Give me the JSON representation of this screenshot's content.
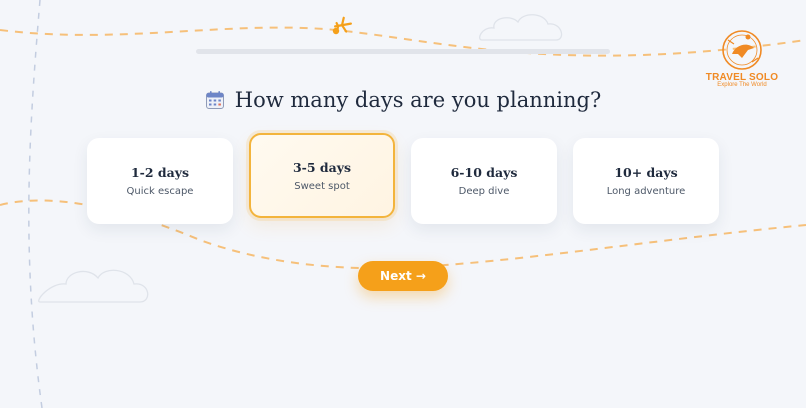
{
  "brand": {
    "name": "TRAVEL SOLO",
    "tagline": "Explore The World",
    "accent_color": "#f5a01a"
  },
  "progress": {
    "value": 0
  },
  "question": {
    "icon": "calendar-icon",
    "text": "How many days are you planning?"
  },
  "options": [
    {
      "title": "1-2 days",
      "subtitle": "Quick escape",
      "selected": false
    },
    {
      "title": "3-5 days",
      "subtitle": "Sweet spot",
      "selected": true
    },
    {
      "title": "6-10 days",
      "subtitle": "Deep dive",
      "selected": false
    },
    {
      "title": "10+ days",
      "subtitle": "Long adventure",
      "selected": false
    }
  ],
  "next_button": {
    "label": "Next →"
  }
}
